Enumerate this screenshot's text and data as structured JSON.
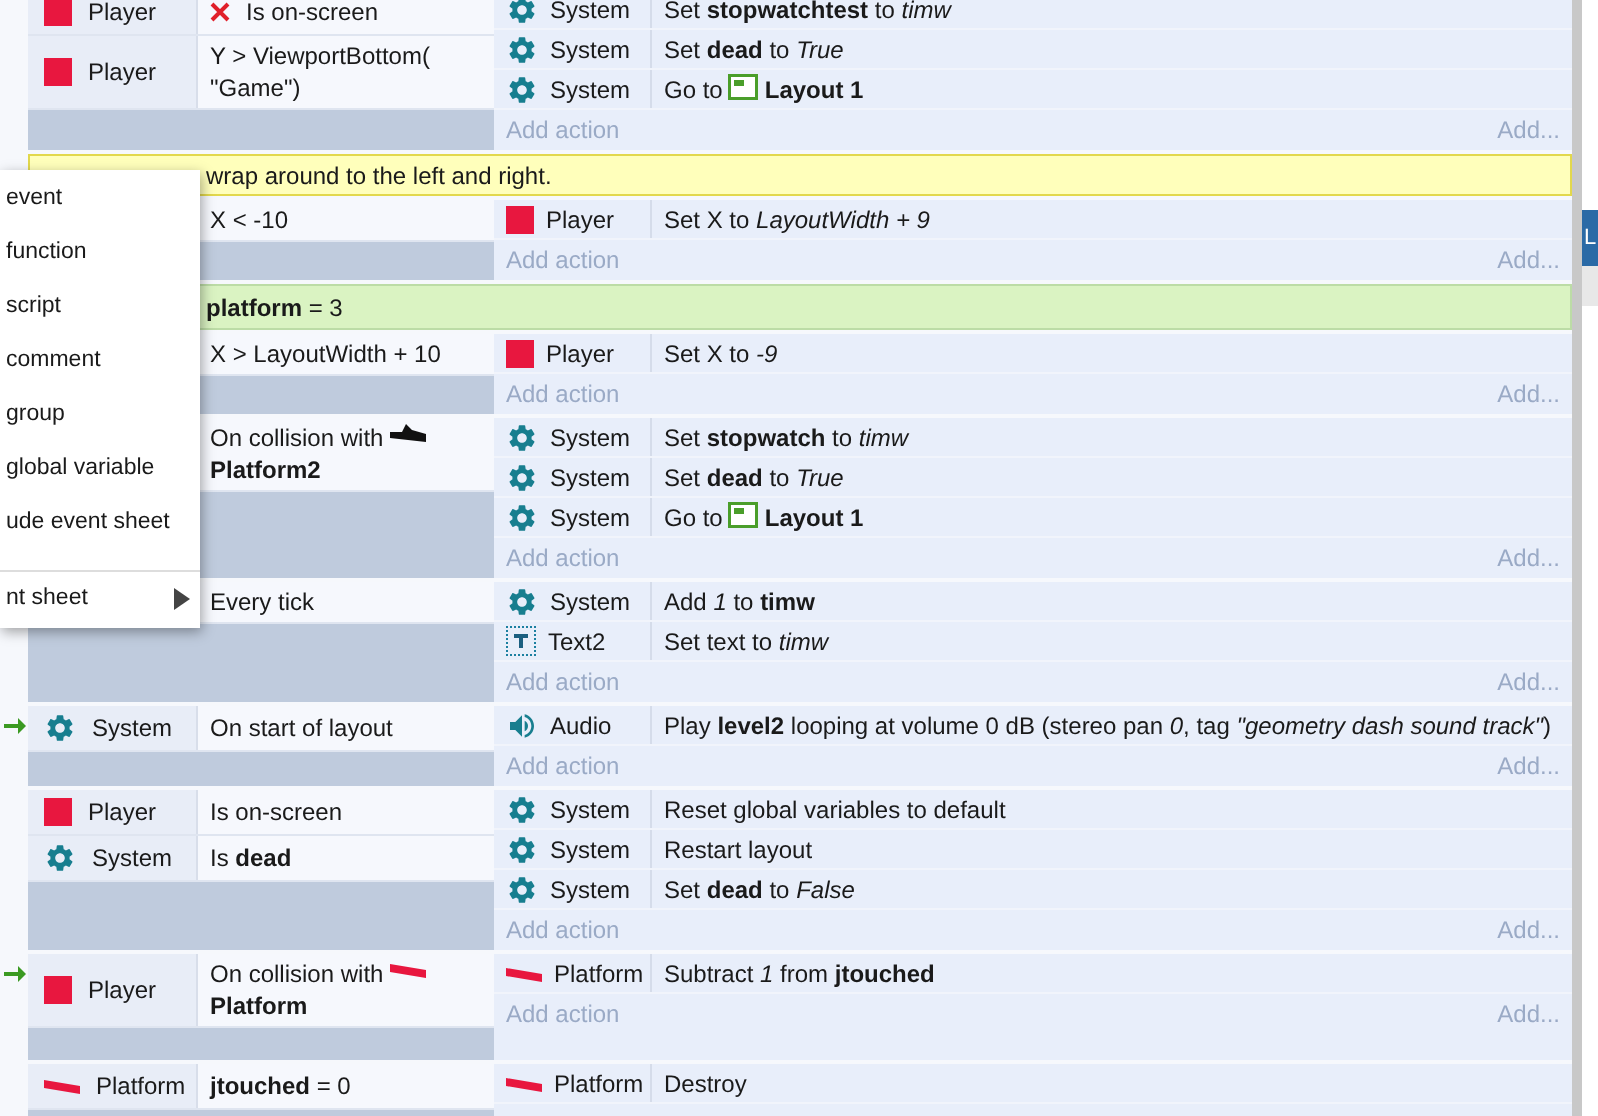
{
  "rows": [
    {
      "kind": "event",
      "trigger": false,
      "conditions": [
        {
          "object": "Player",
          "kind": "sprite",
          "inverted": true,
          "parts": [
            {
              "kind": "text",
              "text": "Is on-screen"
            }
          ]
        },
        {
          "object": "Player",
          "kind": "sprite",
          "inverted": false,
          "parts": [
            {
              "kind": "text",
              "text": "Y > ViewportBottom(\n\"Game\")"
            }
          ]
        }
      ],
      "actions": [
        {
          "object": "System",
          "kind": "system",
          "parts": [
            {
              "kind": "text",
              "text": "Set **stopwatchtest** to *timw*"
            }
          ]
        },
        {
          "object": "System",
          "kind": "system",
          "parts": [
            {
              "kind": "text",
              "text": "Set **dead** to *True*"
            }
          ]
        },
        {
          "object": "System",
          "kind": "system",
          "parts": [
            {
              "kind": "text",
              "text": "Go to"
            },
            {
              "kind": "layout"
            },
            {
              "kind": "text",
              "text": "**Layout 1**"
            }
          ]
        }
      ],
      "add_action": "Add action",
      "add_more": "Add..."
    },
    {
      "kind": "comment",
      "text": "wrap around to the left and right."
    },
    {
      "kind": "event",
      "trigger": false,
      "conditions": [
        {
          "inverted": false,
          "parts": [
            {
              "kind": "text",
              "text": "X < -10"
            }
          ]
        }
      ],
      "actions": [
        {
          "object": "Player",
          "kind": "sprite",
          "parts": [
            {
              "kind": "text",
              "text": "Set X to *LayoutWidth + 9*"
            }
          ]
        }
      ],
      "add_action": "Add action",
      "add_more": "Add..."
    },
    {
      "kind": "variable",
      "text": "**platform** = 3"
    },
    {
      "kind": "event",
      "trigger": false,
      "conditions": [
        {
          "inverted": false,
          "parts": [
            {
              "kind": "text",
              "text": "X > LayoutWidth + 10"
            }
          ]
        }
      ],
      "actions": [
        {
          "object": "Player",
          "kind": "sprite",
          "parts": [
            {
              "kind": "text",
              "text": "Set X to *-9*"
            }
          ]
        }
      ],
      "add_action": "Add action",
      "add_more": "Add..."
    },
    {
      "kind": "event",
      "trigger": false,
      "conditions": [
        {
          "inverted": false,
          "parts": [
            {
              "kind": "text",
              "text": "On collision with"
            },
            {
              "kind": "platform2"
            },
            {
              "kind": "text",
              "text": "**Platform2**"
            }
          ]
        }
      ],
      "actions": [
        {
          "object": "System",
          "kind": "system",
          "parts": [
            {
              "kind": "text",
              "text": "Set **stopwatch** to *timw*"
            }
          ]
        },
        {
          "object": "System",
          "kind": "system",
          "parts": [
            {
              "kind": "text",
              "text": "Set **dead** to *True*"
            }
          ]
        },
        {
          "object": "System",
          "kind": "system",
          "parts": [
            {
              "kind": "text",
              "text": "Go to"
            },
            {
              "kind": "layout"
            },
            {
              "kind": "text",
              "text": "**Layout 1**"
            }
          ]
        }
      ],
      "add_action": "Add action",
      "add_more": "Add..."
    },
    {
      "kind": "event",
      "trigger": false,
      "conditions": [
        {
          "inverted": false,
          "parts": [
            {
              "kind": "text",
              "text": "Every tick"
            }
          ]
        }
      ],
      "actions": [
        {
          "object": "System",
          "kind": "system",
          "parts": [
            {
              "kind": "text",
              "text": "Add *1* to **timw**"
            }
          ]
        },
        {
          "object": "Text2",
          "kind": "text",
          "parts": [
            {
              "kind": "text",
              "text": "Set text to *timw*"
            }
          ]
        }
      ],
      "add_action": "Add action",
      "add_more": "Add..."
    },
    {
      "kind": "event",
      "trigger": true,
      "conditions": [
        {
          "object": "System",
          "kind": "system",
          "inverted": false,
          "parts": [
            {
              "kind": "text",
              "text": "On start of layout"
            }
          ]
        }
      ],
      "actions": [
        {
          "object": "Audio",
          "kind": "audio",
          "parts": [
            {
              "kind": "text",
              "text": "Play **level2** looping at volume 0 dB (stereo pan *0*, tag *\"geometry dash sound track\"*)"
            }
          ]
        }
      ],
      "add_action": "Add action",
      "add_more": "Add..."
    },
    {
      "kind": "event",
      "trigger": false,
      "conditions": [
        {
          "object": "Player",
          "kind": "sprite",
          "inverted": false,
          "parts": [
            {
              "kind": "text",
              "text": "Is on-screen"
            }
          ]
        },
        {
          "object": "System",
          "kind": "system",
          "inverted": false,
          "parts": [
            {
              "kind": "text",
              "text": "Is **dead**"
            }
          ]
        }
      ],
      "actions": [
        {
          "object": "System",
          "kind": "system",
          "parts": [
            {
              "kind": "text",
              "text": "Reset global variables to default"
            }
          ]
        },
        {
          "object": "System",
          "kind": "system",
          "parts": [
            {
              "kind": "text",
              "text": "Restart layout"
            }
          ]
        },
        {
          "object": "System",
          "kind": "system",
          "parts": [
            {
              "kind": "text",
              "text": "Set **dead** to *False*"
            }
          ]
        }
      ],
      "add_action": "Add action",
      "add_more": "Add..."
    },
    {
      "kind": "event",
      "trigger": true,
      "conditions": [
        {
          "object": "Player",
          "kind": "sprite",
          "inverted": false,
          "parts": [
            {
              "kind": "text",
              "text": "On collision with"
            },
            {
              "kind": "platform"
            },
            {
              "kind": "text",
              "text": "**Platform**"
            }
          ]
        }
      ],
      "actions": [
        {
          "object": "Platform",
          "kind": "platform",
          "parts": [
            {
              "kind": "text",
              "text": "Subtract *1* from **jtouched**"
            }
          ]
        }
      ],
      "add_action": "Add action",
      "add_more": "Add..."
    },
    {
      "kind": "event",
      "trigger": false,
      "conditions": [
        {
          "object": "Platform",
          "kind": "platform",
          "inverted": false,
          "parts": [
            {
              "kind": "text",
              "text": "**jtouched** = 0"
            }
          ]
        }
      ],
      "actions": [
        {
          "object": "Platform",
          "kind": "platform",
          "parts": [
            {
              "kind": "text",
              "text": "Destroy"
            }
          ]
        }
      ]
    }
  ],
  "menu": [
    {
      "label": "event",
      "submenu": false
    },
    {
      "label": "function",
      "submenu": false
    },
    {
      "label": "script",
      "submenu": false
    },
    {
      "label": "comment",
      "submenu": false
    },
    {
      "label": "group",
      "submenu": false
    },
    {
      "label": "global variable",
      "submenu": false
    },
    {
      "label": "ude event sheet",
      "submenu": false
    },
    {
      "label": "nt sheet",
      "submenu": true
    }
  ],
  "side_tab": "L"
}
